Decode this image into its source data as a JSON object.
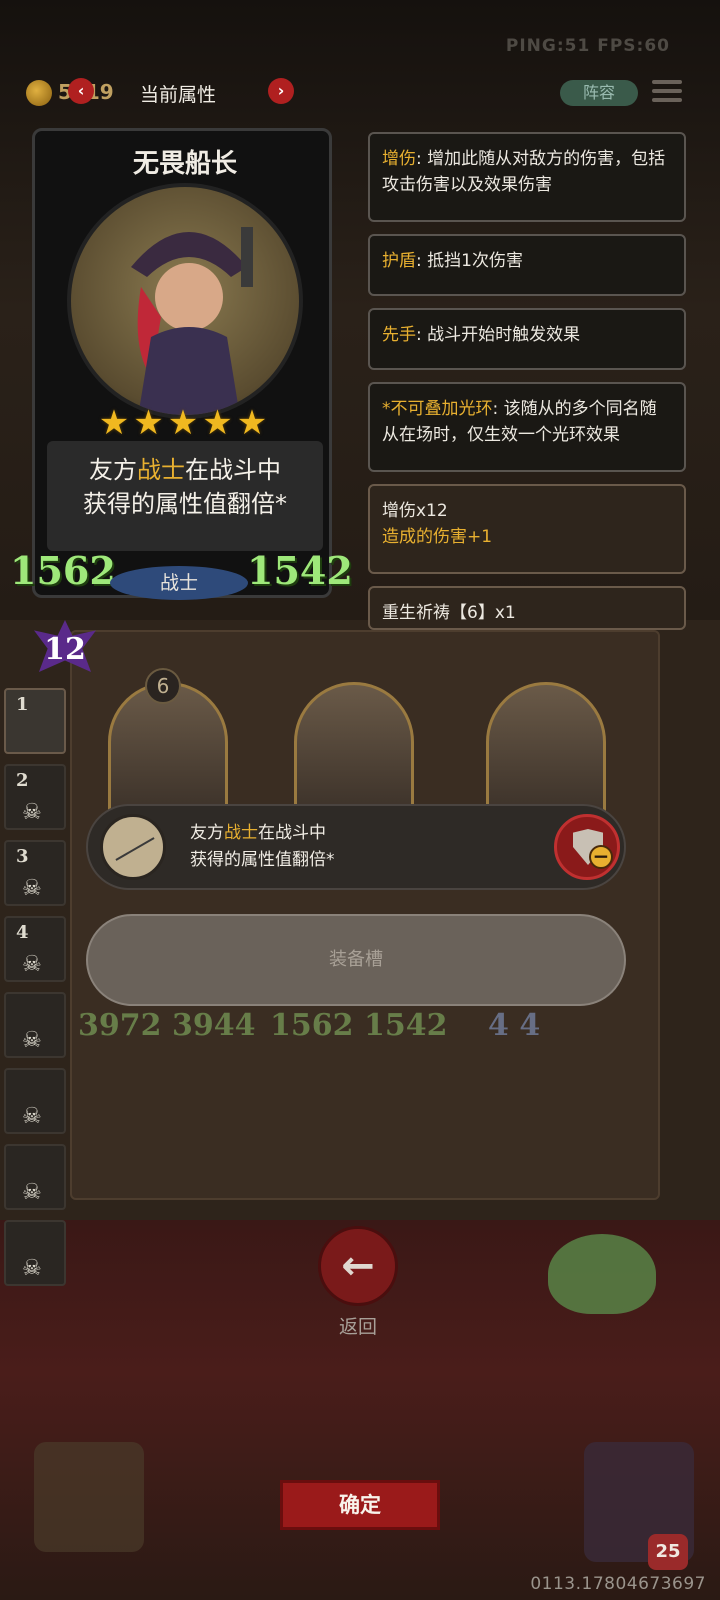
{
  "status": {
    "ping_fps": "PING:51   FPS:60"
  },
  "topbar": {
    "coins": "5319",
    "title": "当前属性",
    "prev_icon": "chevron-left-icon",
    "next_icon": "chevron-right-icon",
    "lineup_label": "阵容",
    "menu_icon": "hamburger-icon"
  },
  "hero": {
    "name": "无畏船长",
    "stars": "★★★★★",
    "desc_line1_pre": "友方",
    "desc_line1_kw": "战士",
    "desc_line1_post": "在战斗中",
    "desc_line2": "获得的属性值翻倍*",
    "attack": "1562",
    "health": "1542",
    "class": "战士",
    "level": "12"
  },
  "tips": [
    {
      "kw": "增伤",
      "text": ": 增加此随从对敌方的伤害，包括攻击伤害以及效果伤害"
    },
    {
      "kw": "护盾",
      "text": ": 抵挡1次伤害"
    },
    {
      "kw": "先手",
      "text": ": 战斗开始时触发效果"
    },
    {
      "kw": "*不可叠加光环",
      "text": ": 该随从的多个同名随从在场时，仅生效一个光环效果"
    }
  ],
  "buffs": [
    {
      "line1": "增伤x12",
      "line2": "造成的伤害+1"
    },
    {
      "line1": "重生祈祷【6】x1"
    }
  ],
  "slots": [
    "1",
    "2",
    "3",
    "4",
    "",
    "",
    "",
    ""
  ],
  "board": {
    "unit_level": "6",
    "stats_left": "3972 3944",
    "stats_mid": "1562 1542",
    "stats_right": "4      4"
  },
  "equip": {
    "desc_pre": "友方",
    "desc_kw": "战士",
    "desc_post": "在战斗中",
    "desc_line2": "获得的属性值翻倍*",
    "item_icon": "spear-icon",
    "remove_icon": "shield-minus-icon",
    "slot_label": "装备槽"
  },
  "back": {
    "label": "返回",
    "icon": "arrow-left-icon"
  },
  "confirm_label": "确定",
  "corner_badge": "25",
  "footer_id": "0113.17804673697"
}
